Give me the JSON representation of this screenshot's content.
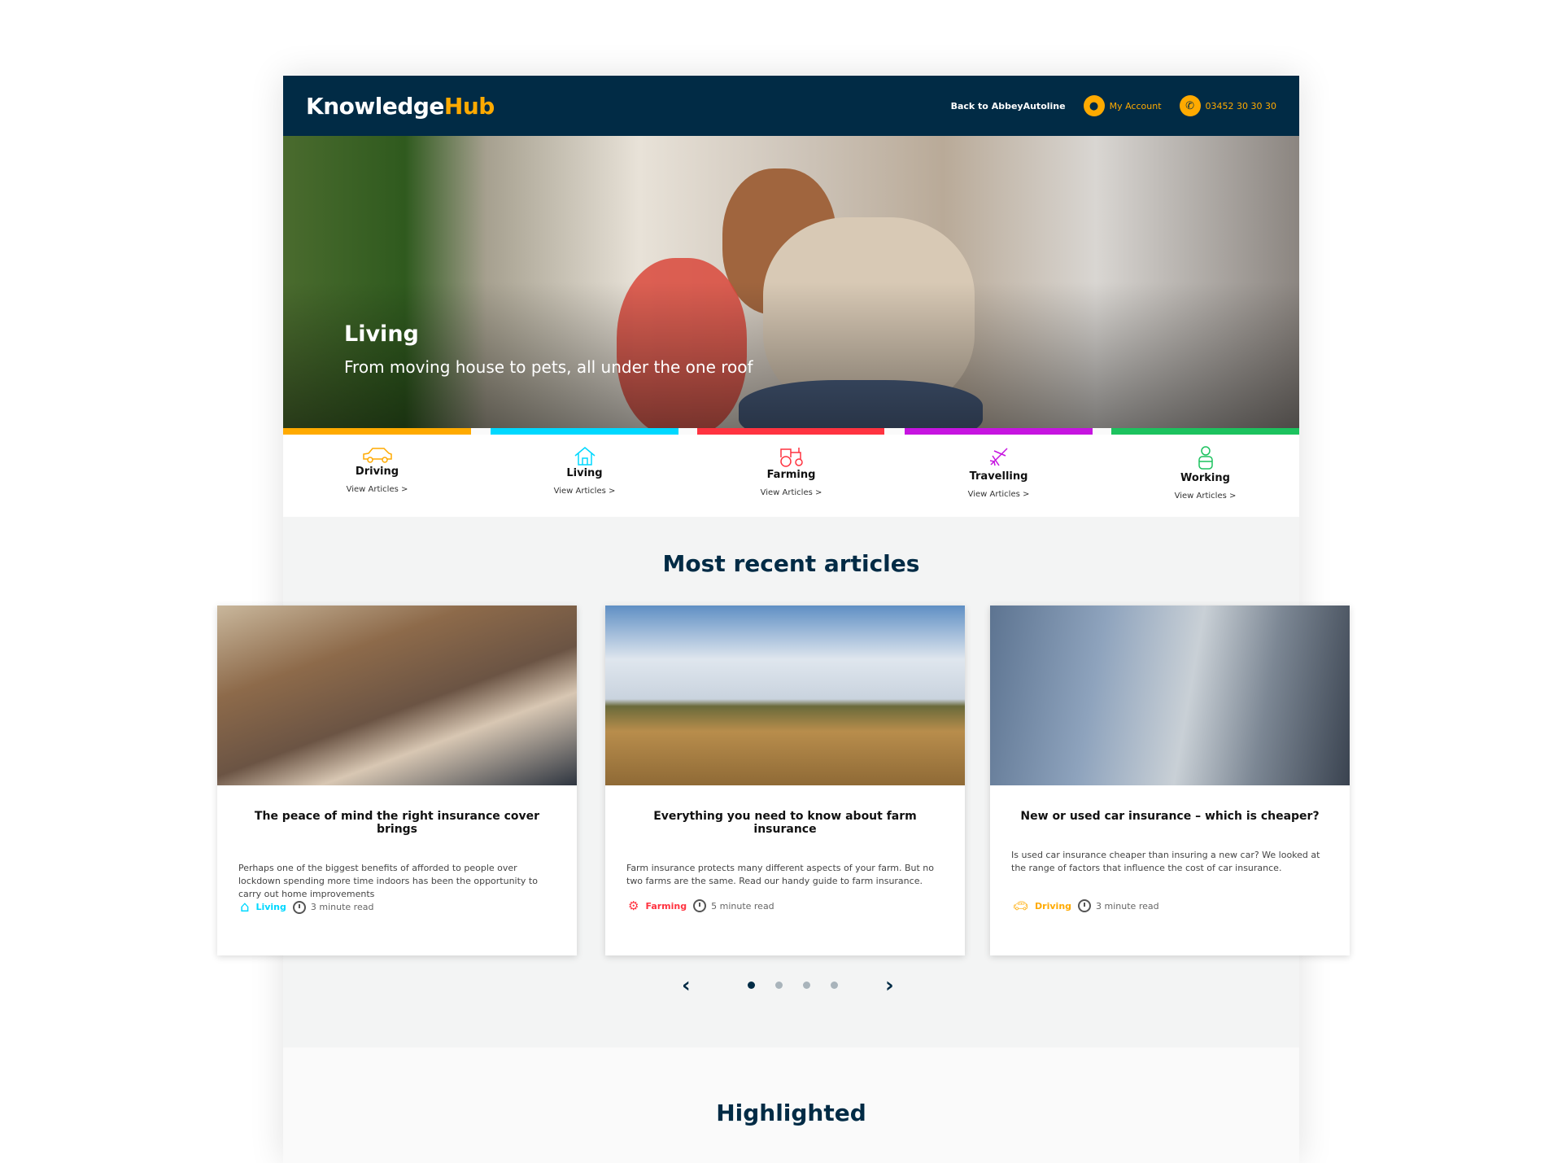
{
  "header": {
    "logo_main": "Knowledge",
    "logo_accent": "Hub",
    "back_link": "Back to AbbeyAutoline",
    "account": "My Account",
    "phone": "03452 30 30 30"
  },
  "hero": {
    "title": "Living",
    "subtitle": "From moving house to pets, all under the one roof"
  },
  "categories": [
    {
      "name": "Driving",
      "link": "View Articles >",
      "color": "#ffaa00",
      "icon": "car-icon"
    },
    {
      "name": "Living",
      "link": "View Articles >",
      "color": "#00d8ff",
      "icon": "house-icon"
    },
    {
      "name": "Farming",
      "link": "View Articles >",
      "color": "#ff3340",
      "icon": "tractor-icon"
    },
    {
      "name": "Travelling",
      "link": "View Articles >",
      "color": "#c614e0",
      "icon": "plane-icon"
    },
    {
      "name": "Working",
      "link": "View Articles >",
      "color": "#1cc25e",
      "icon": "person-icon"
    }
  ],
  "recent": {
    "title": "Most recent articles",
    "articles": [
      {
        "title": "The peace of mind the right insurance cover brings",
        "excerpt": "Perhaps one of the biggest benefits of afforded to people over lockdown spending more time indoors has been the opportunity to carry out home improvements",
        "tag": "Living",
        "read": "3 minute read"
      },
      {
        "title": "Everything you need to know about farm insurance",
        "excerpt": "Farm insurance protects many different aspects of your farm. But no two farms are the same. Read our handy guide to farm insurance.",
        "tag": "Farming",
        "read": "5 minute read"
      },
      {
        "title": "New or used car insurance – which is cheaper?",
        "excerpt": "Is used car insurance cheaper than insuring a new car? We looked at the range of factors that influence the cost of car insurance.",
        "tag": "Driving",
        "read": "3 minute read"
      }
    ],
    "carousel": {
      "prev": "‹",
      "next": "›",
      "pages": 4,
      "active": 1
    }
  },
  "highlighted": {
    "title": "Highlighted"
  }
}
